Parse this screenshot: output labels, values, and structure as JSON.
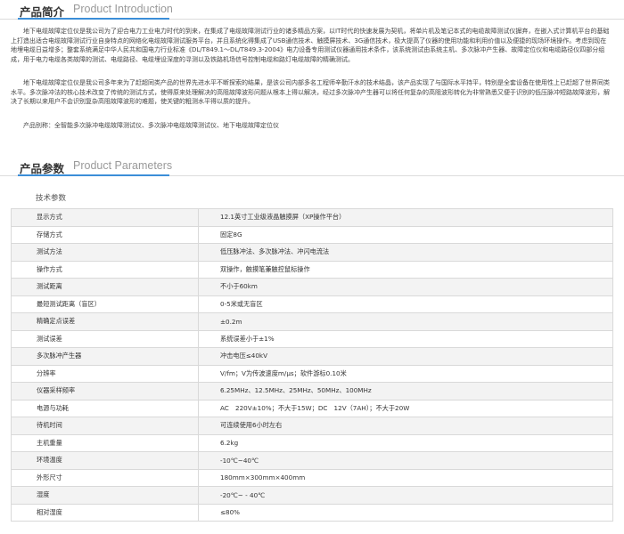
{
  "intro_section": {
    "title_cn": "产品简介",
    "title_en": "Product Introduction",
    "paragraph1": "地下电缆故障定位仪是我公司为了迎合电力工业电力时代的到来，在集成了电缆故障测试行业的诸多精品方案，以IT时代的快速发展为契机，将单片机及笔记本式的电缆故障测试仪摒弃，在嵌入式计算机平台的基础上打造出适合电缆故障测试行业自身特点的网络化电缆故障测试服务平台，并且系统化得集成了USB通信技术、触摸屏技术、3G通信技术，极大提高了仪器的使用功能和利用价值以及便捷的现场环境操作。考虑到现在地埋电缆日益增多；整套系统满足中华人民共和国电力行业标准《DL/T849.1～DL/T849.3-2004》电力设备专用测试仪器通用技术条件，该系统测试由系统主机、多次脉冲产生器、故障定位仪和电缆路径仪四部分组成，用于电力电缆各类故障的测试、电缆路径、电缆埋设深度的寻测以及铁路机场信号控制电缆和路灯电缆故障的精确测试。",
    "paragraph2": "地下电缆故障定位仪是我公司多年来为了赶超同类产品的世界先进水平不断探索的结果，是该公司内部多名工程师辛勤汗水的技术结晶，该产品实现了与国际水平持平，特别是全套设备在使用性上已赶超了世界同类水平。多次脉冲法的核心技术改变了传统的测试方式，使得原来处理解决的高阻故障波形问题从根本上得以解决，经过多次脉冲产生器可以将任何复杂的高阻波形转化为非常熟悉又便于识别的低压脉冲短路故障波形，解决了长期以来用户不会识别复杂高阻故障波形的难题，使关键的粗测水平得以质的提升。",
    "aliases": "产品别称：全智能多次脉冲电缆故障测试仪、多次脉冲电缆故障测试仪、地下电缆故障定位仪"
  },
  "params_section": {
    "title_cn": "产品参数",
    "title_en": "Product Parameters",
    "table_title": "技术参数",
    "rows": [
      {
        "key": "显示方式",
        "value": "12.1英寸工业级液晶触摸屏（XP操作平台）"
      },
      {
        "key": "存储方式",
        "value": "固定8G"
      },
      {
        "key": "测试方法",
        "value": "低压脉冲法、多次脉冲法、冲闪电流法"
      },
      {
        "key": "操作方式",
        "value": "双操作，触摸笔兼触控鼠标操作"
      },
      {
        "key": "测试距离",
        "value": "不小于60km"
      },
      {
        "key": "最短测试距离（盲区）",
        "value": "0-5米或无盲区"
      },
      {
        "key": "精确定点误差",
        "value": "±0.2m"
      },
      {
        "key": "测试误差",
        "value": "系统误差小于±1%"
      },
      {
        "key": "多次脉冲产生器",
        "value": "冲击电压≤40kV"
      },
      {
        "key": "分辨率",
        "value": "V/fm；V为传波速度m/μs；软件游标0.10米"
      },
      {
        "key": "仪器采样频率",
        "value": "6.25MHz、12.5MHz、25MHz、50MHz、100MHz"
      },
      {
        "key": "电源与功耗",
        "value": "AC　220V±10%；不大于15W；DC　12V（7AH）；不大于20W"
      },
      {
        "key": "待机时间",
        "value": "可连续使用6小时左右"
      },
      {
        "key": "主机重量",
        "value": "6.2kg"
      },
      {
        "key": "环境温度",
        "value": "-10℃~40℃"
      },
      {
        "key": "外形尺寸",
        "value": "180mm×300mm×400mm"
      },
      {
        "key": "湿度",
        "value": "-20℃~ - 40℃"
      },
      {
        "key": "相对湿度",
        "value": "≤80%"
      }
    ]
  }
}
